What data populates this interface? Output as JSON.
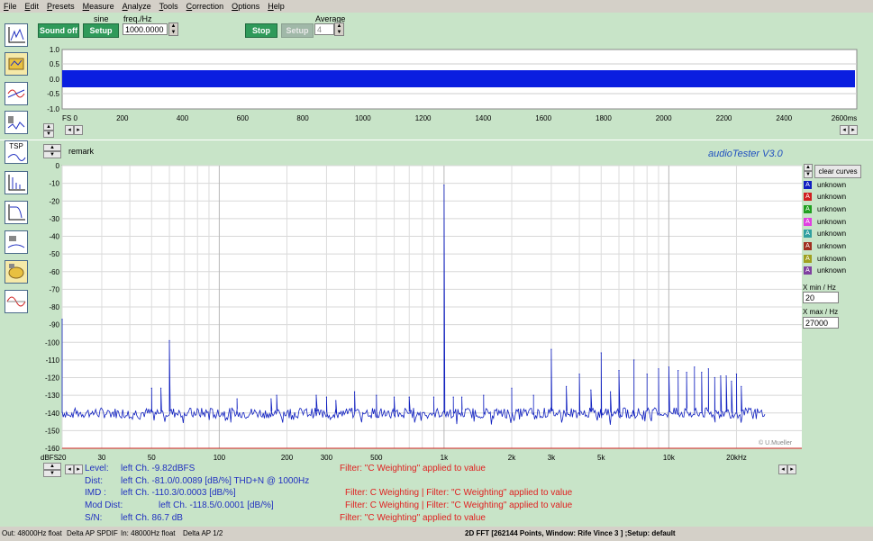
{
  "menu": [
    "File",
    "Edit",
    "Presets",
    "Measure",
    "Analyze",
    "Tools",
    "Correction",
    "Options",
    "Help"
  ],
  "toolbar": {
    "sound_off": "Sound off",
    "setup1": "Setup",
    "signal_type": "sine",
    "freq_label": "freq./Hz",
    "freq_value": "1000.0000",
    "stop": "Stop",
    "setup2": "Setup",
    "average_label": "Average",
    "average_value": "4"
  },
  "side_icons": [
    "scope-icon",
    "chart-folder-icon",
    "frequency-response-icon",
    "speaker-distortion-icon",
    "tsp-icon",
    "impulse-icon",
    "filter-response-icon",
    "speaker-measure-icon",
    "loudspeaker-icon",
    "sine-curve-icon"
  ],
  "tsp_label": "TSP",
  "scope": {
    "y_ticks": [
      "1.0",
      "0.5",
      "0.0",
      "-0.5",
      "-1.0"
    ],
    "x_ticks": [
      "FS 0",
      "200",
      "400",
      "600",
      "800",
      "1000",
      "1200",
      "1400",
      "1600",
      "1800",
      "2000",
      "2200",
      "2400",
      "2600ms"
    ]
  },
  "remark": "remark",
  "app_title": "audioTester  V3.0",
  "clear_curves": "clear curves",
  "legend": [
    {
      "letter": "A",
      "label": "unknown",
      "color": "#1020c0"
    },
    {
      "letter": "A",
      "label": "unknown",
      "color": "#d02020"
    },
    {
      "letter": "A",
      "label": "unknown",
      "color": "#20a020"
    },
    {
      "letter": "A",
      "label": "unknown",
      "color": "#e040e0"
    },
    {
      "letter": "A",
      "label": "unknown",
      "color": "#30a0a0"
    },
    {
      "letter": "A",
      "label": "unknown",
      "color": "#a03020"
    },
    {
      "letter": "A",
      "label": "unknown",
      "color": "#a0a020"
    },
    {
      "letter": "A",
      "label": "unknown",
      "color": "#8040a0"
    }
  ],
  "xmin_label": "X min / Hz",
  "xmin_value": "20",
  "xmax_label": "X max / Hz",
  "xmax_value": "27000",
  "copyright": "© U.Mueller",
  "chart_data": {
    "type": "line",
    "title": "",
    "xlabel": "",
    "ylabel": "",
    "x_scale": "log",
    "xlim": [
      20,
      27000
    ],
    "ylim": [
      -160,
      0
    ],
    "grid": true,
    "y_ticks": [
      0,
      -10,
      -20,
      -30,
      -40,
      -50,
      -60,
      -70,
      -80,
      -90,
      -100,
      -110,
      -120,
      -130,
      -140,
      -150,
      -160
    ],
    "y_tick_labels": [
      "0",
      "-10",
      "-20",
      "-30",
      "-40",
      "-50",
      "-60",
      "-70",
      "-80",
      "-90",
      "-100",
      "-110",
      "-120",
      "-130",
      "-140",
      "-150",
      "-160"
    ],
    "x_tick_labels": [
      {
        "f": 20,
        "t": "20"
      },
      {
        "f": 30,
        "t": "30"
      },
      {
        "f": 50,
        "t": "50"
      },
      {
        "f": 100,
        "t": "100"
      },
      {
        "f": 200,
        "t": "200"
      },
      {
        "f": 300,
        "t": "300"
      },
      {
        "f": 500,
        "t": "500"
      },
      {
        "f": 1000,
        "t": "1k"
      },
      {
        "f": 2000,
        "t": "2k"
      },
      {
        "f": 3000,
        "t": "3k"
      },
      {
        "f": 5000,
        "t": "5k"
      },
      {
        "f": 10000,
        "t": "10k"
      },
      {
        "f": 20000,
        "t": "20kHz"
      }
    ],
    "x_unit_label": "dBFS",
    "noise_floor": -140,
    "series": [
      {
        "color": "#1020c0",
        "peaks": [
          {
            "x": 20,
            "y": -87
          },
          {
            "x": 50,
            "y": -126
          },
          {
            "x": 55,
            "y": -126
          },
          {
            "x": 60,
            "y": -99
          },
          {
            "x": 120,
            "y": -132
          },
          {
            "x": 170,
            "y": -132
          },
          {
            "x": 180,
            "y": -130
          },
          {
            "x": 270,
            "y": -130
          },
          {
            "x": 300,
            "y": -131
          },
          {
            "x": 330,
            "y": -133
          },
          {
            "x": 400,
            "y": -128
          },
          {
            "x": 500,
            "y": -130
          },
          {
            "x": 600,
            "y": -131
          },
          {
            "x": 700,
            "y": -131
          },
          {
            "x": 900,
            "y": -131
          },
          {
            "x": 1000,
            "y": -11
          },
          {
            "x": 1100,
            "y": -131
          },
          {
            "x": 1200,
            "y": -131
          },
          {
            "x": 1500,
            "y": -130
          },
          {
            "x": 2000,
            "y": -126
          },
          {
            "x": 2500,
            "y": -130
          },
          {
            "x": 3000,
            "y": -104
          },
          {
            "x": 3500,
            "y": -125
          },
          {
            "x": 4000,
            "y": -118
          },
          {
            "x": 4500,
            "y": -127
          },
          {
            "x": 5000,
            "y": -106
          },
          {
            "x": 5500,
            "y": -128
          },
          {
            "x": 6000,
            "y": -116
          },
          {
            "x": 7000,
            "y": -110
          },
          {
            "x": 8000,
            "y": -118
          },
          {
            "x": 9000,
            "y": -115
          },
          {
            "x": 10000,
            "y": -114
          },
          {
            "x": 11000,
            "y": -116
          },
          {
            "x": 12000,
            "y": -117
          },
          {
            "x": 13000,
            "y": -114
          },
          {
            "x": 14000,
            "y": -117
          },
          {
            "x": 15000,
            "y": -115
          },
          {
            "x": 16000,
            "y": -120
          },
          {
            "x": 17000,
            "y": -119
          },
          {
            "x": 18000,
            "y": -119
          },
          {
            "x": 19000,
            "y": -122
          },
          {
            "x": 20000,
            "y": -118
          },
          {
            "x": 21000,
            "y": -125
          }
        ]
      }
    ]
  },
  "stats": {
    "level_label": "Level:",
    "level_value": "left Ch. -9.82dBFS",
    "level_filter": "Filter: \"C Weighting\" applied to value",
    "dist_label": "Dist:",
    "dist_value": "left Ch. -81.0/0.0089 [dB/%] THD+N  @ 1000Hz",
    "imd_label": "IMD  :",
    "imd_value": "left Ch. -110.3/0.0003 [dB/%]",
    "imd_filter": "Filter: C Weighting | Filter: \"C Weighting\" applied to value",
    "moddist_label": "Mod Dist:",
    "moddist_value": "left Ch. -118.5/0.0001 [dB/%]",
    "moddist_filter": "Filter: C Weighting | Filter: \"C Weighting\" applied to value",
    "sn_label": "S/N:",
    "sn_value": "left Ch. 86.7 dB",
    "sn_filter": "Filter: \"C Weighting\" applied to value"
  },
  "status": {
    "out": "Out: 48000Hz float",
    "out_dev": "Delta AP SPDIF",
    "in": "In: 48000Hz float",
    "in_dev": "Delta AP 1/2",
    "fft": "2D FFT [262144 Points, Window: Rife Vince 3 ] ;Setup:  default"
  }
}
